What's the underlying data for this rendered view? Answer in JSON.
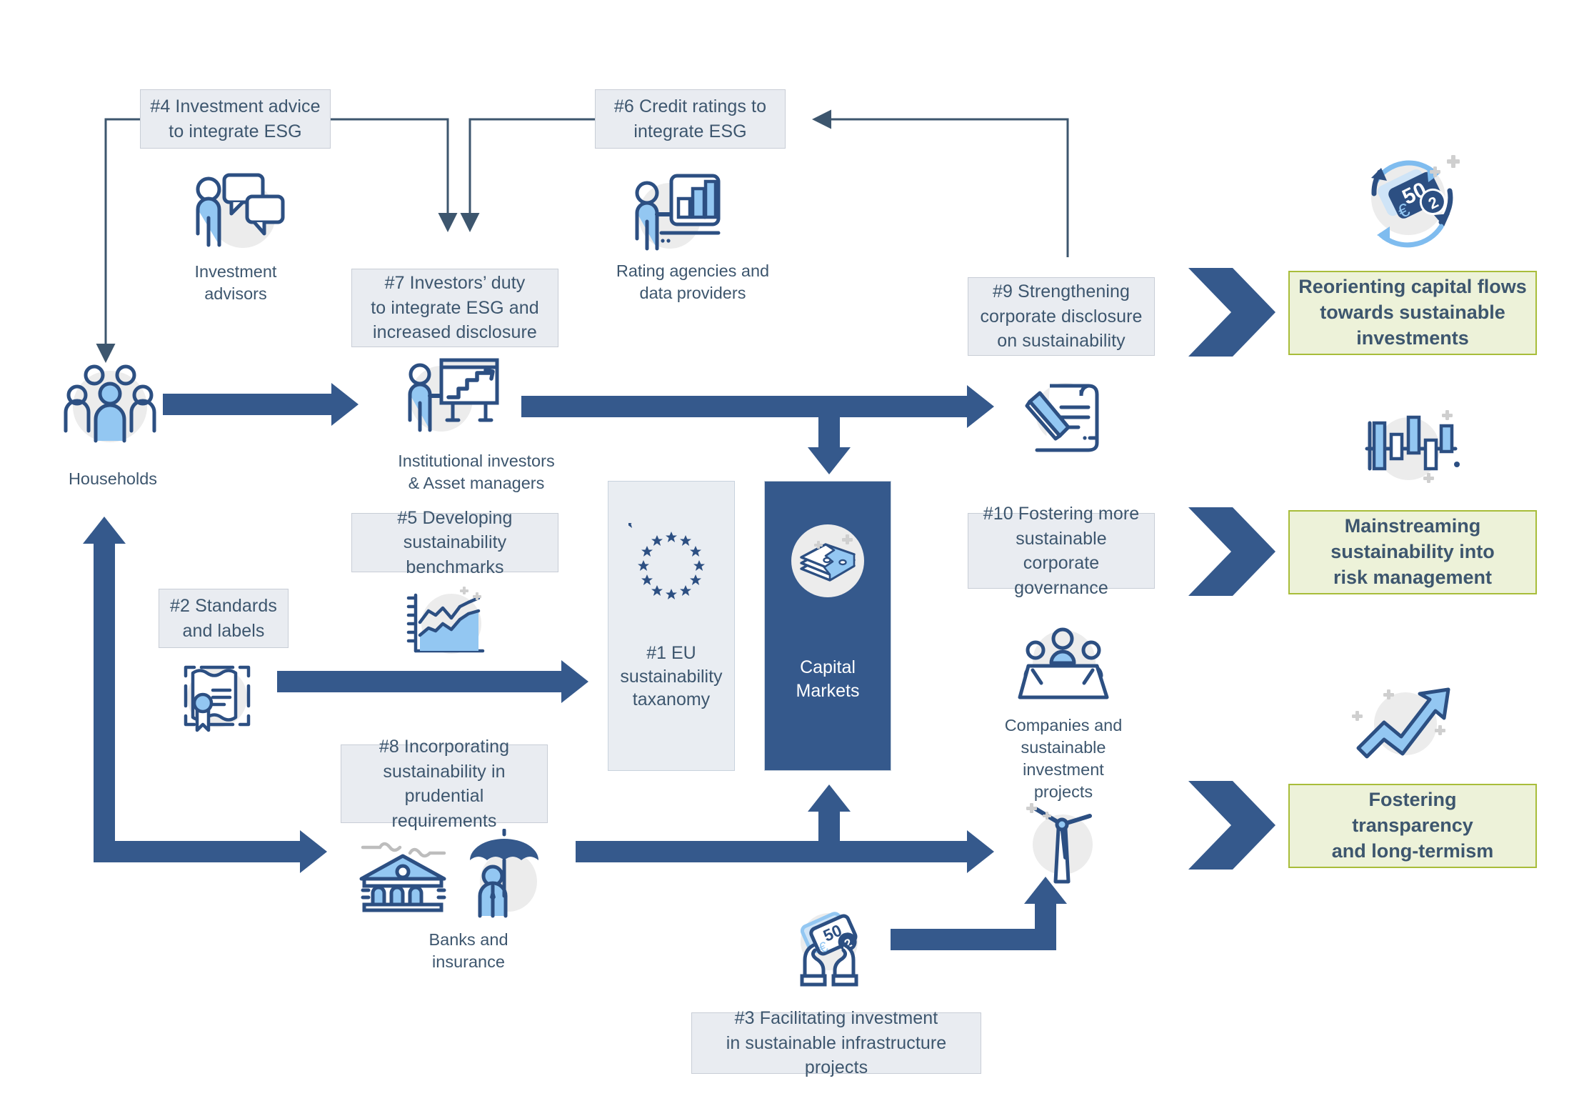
{
  "diagram": {
    "title": "EU Action Plan on Financing Sustainable Growth",
    "colors": {
      "dark_blue": "#35598c",
      "mid_blue": "#3d566e",
      "light_blue": "#93c7f2",
      "box_grey_fill": "#e9ecf1",
      "box_grey_border": "#c8cdd6",
      "outcome_fill": "#edf2d9",
      "outcome_border": "#a8bd3a",
      "icon_bg_grey": "#e8e8e8",
      "line_thin": "#3d566e",
      "arrow_thick": "#35598c"
    }
  },
  "actions": {
    "a1": "#1 EU\nsustainability\ntaxanomy",
    "a2": "#2 Standards\nand labels",
    "a3": "#3 Facilitating investment\nin sustainable infrastructure projects",
    "a4": "#4 Investment advice\nto integrate ESG",
    "a5": "#5 Developing\nsustainability benchmarks",
    "a6": "#6 Credit ratings to\nintegrate ESG",
    "a7": "#7 Investors’ duty\nto integrate ESG and\nincreased disclosure",
    "a8": "#8 Incorporating\nsustainability in\nprudential requirements",
    "a9": "#9 Strengthening\ncorporate disclosure\non sustainability",
    "a10": "#10 Fostering more\nsustainable corporate\ngovernance"
  },
  "actors": {
    "households": "Households",
    "investment_advisors": "Investment\nadvisors",
    "institutional_investors": "Institutional investors\n& Asset managers",
    "rating_agencies": "Rating agencies and\ndata providers",
    "banks": "Banks and\ninsurance",
    "companies": "Companies and\nsustainable\ninvestment projects",
    "capital_markets": "Capital\nMarkets"
  },
  "outcomes": [
    {
      "id": "o1",
      "label": "Reorienting capital flows\ntowards sustainable\ninvestments",
      "icon": "money-cycle-icon"
    },
    {
      "id": "o2",
      "label": "Mainstreaming\nsustainability into\nrisk management",
      "icon": "bar-chart-volatility-icon"
    },
    {
      "id": "o3",
      "label": "Fostering\ntransparency\nand long-termism",
      "icon": "growth-arrow-icon"
    }
  ],
  "icons": {
    "households": "group-of-people-icon",
    "investment_advisors": "person-speech-bubbles-icon",
    "institutional_investors": "person-presenting-chart-icon",
    "rating_agencies": "person-bar-chart-board-icon",
    "standards_labels": "certificate-seal-icon",
    "benchmarks": "line-area-chart-icon",
    "banks": "bank-building-icon",
    "insurance": "person-umbrella-icon",
    "eu_stars": "eu-stars-icon",
    "capital_markets": "cash-stack-icon",
    "disclosure": "scroll-pen-icon",
    "companies": "boardroom-table-icon",
    "infrastructure": "wind-turbine-icon",
    "facilitating_investment": "hands-holding-money-icon"
  }
}
